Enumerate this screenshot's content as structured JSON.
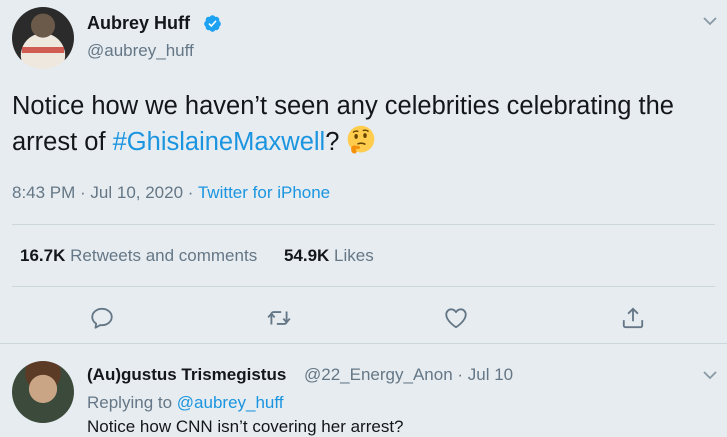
{
  "tweet": {
    "author_name": "Aubrey Huff",
    "handle": "@aubrey_huff",
    "text_before": "Notice how we haven’t seen any celebrities celebrating the arrest of ",
    "hashtag": "#GhislaineMaxwell",
    "text_after": "?",
    "emoji": "thinking-face",
    "time": "8:43 PM · Jul 10, 2020 · ",
    "source": "Twitter for iPhone",
    "retweets_count": "16.7K",
    "retweets_label": "Retweets and comments",
    "likes_count": "54.9K",
    "likes_label": "Likes"
  },
  "actions": [
    {
      "name": "reply-icon"
    },
    {
      "name": "retweet-icon"
    },
    {
      "name": "like-icon"
    },
    {
      "name": "share-icon"
    }
  ],
  "reply": {
    "author_name": "(Au)gustus Trismegistus",
    "handle_and_date": "@22_Energy_Anon · Jul 10",
    "replying_prefix": "Replying to ",
    "replying_to": "@aubrey_huff",
    "text": "Notice how CNN isn’t covering her arrest?"
  },
  "colors": {
    "background": "#e6ecf0",
    "link": "#1b95e0",
    "secondary": "#657786",
    "primary_text": "#14171a"
  }
}
